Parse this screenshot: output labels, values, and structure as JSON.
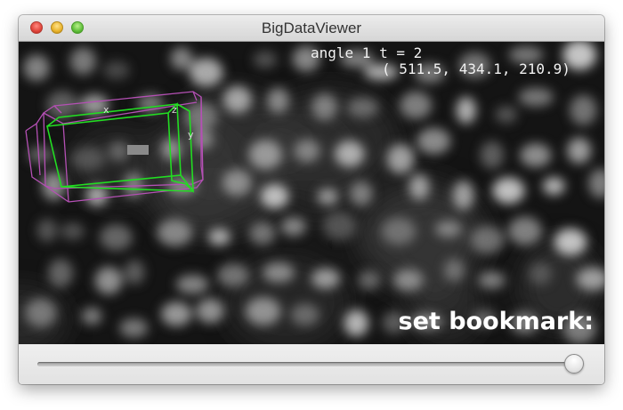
{
  "window": {
    "title": "BigDataViewer",
    "controls": [
      "close-icon",
      "minimize-icon",
      "zoom-icon"
    ]
  },
  "viewer": {
    "info_line": "angle 1 t = 2",
    "coordinates": "( 511.5, 434.1, 210.9)",
    "bookmark_text": "set bookmark:",
    "box_labels": {
      "x": "x",
      "y": "y",
      "z": "z"
    },
    "colors": {
      "background": "#111111",
      "source_box": "#b450b4",
      "view_box": "#22dd22"
    }
  },
  "timepoint_slider": {
    "value_fraction": 1.0
  }
}
